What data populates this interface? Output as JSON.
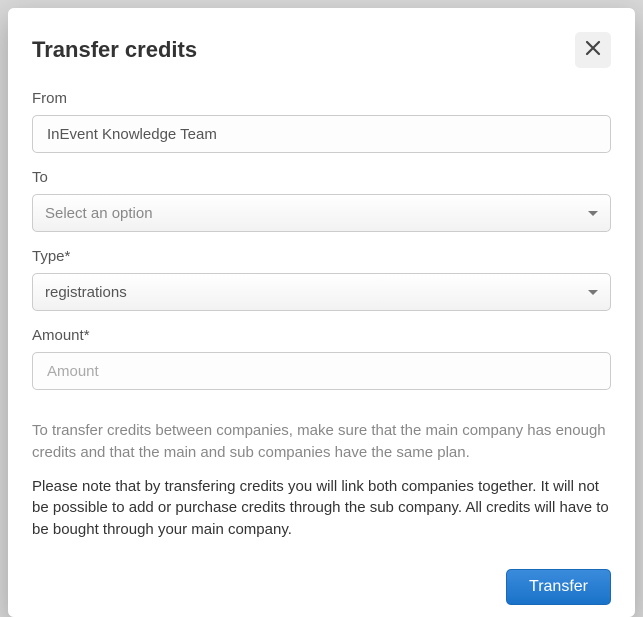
{
  "modal": {
    "title": "Transfer credits",
    "close_icon": "×"
  },
  "form": {
    "from": {
      "label": "From",
      "value": "InEvent Knowledge Team"
    },
    "to": {
      "label": "To",
      "placeholder": "Select an option"
    },
    "type": {
      "label": "Type*",
      "selected": "registrations"
    },
    "amount": {
      "label": "Amount*",
      "placeholder": "Amount"
    }
  },
  "help_text": "To transfer credits between companies, make sure that the main company has enough credits and that the main and sub companies have the same plan.",
  "note_text": "Please note that by transfering credits you will link both companies together. It will not be possible to add or purchase credits through the sub company. All credits will have to be bought through your main company.",
  "footer": {
    "transfer_label": "Transfer"
  }
}
